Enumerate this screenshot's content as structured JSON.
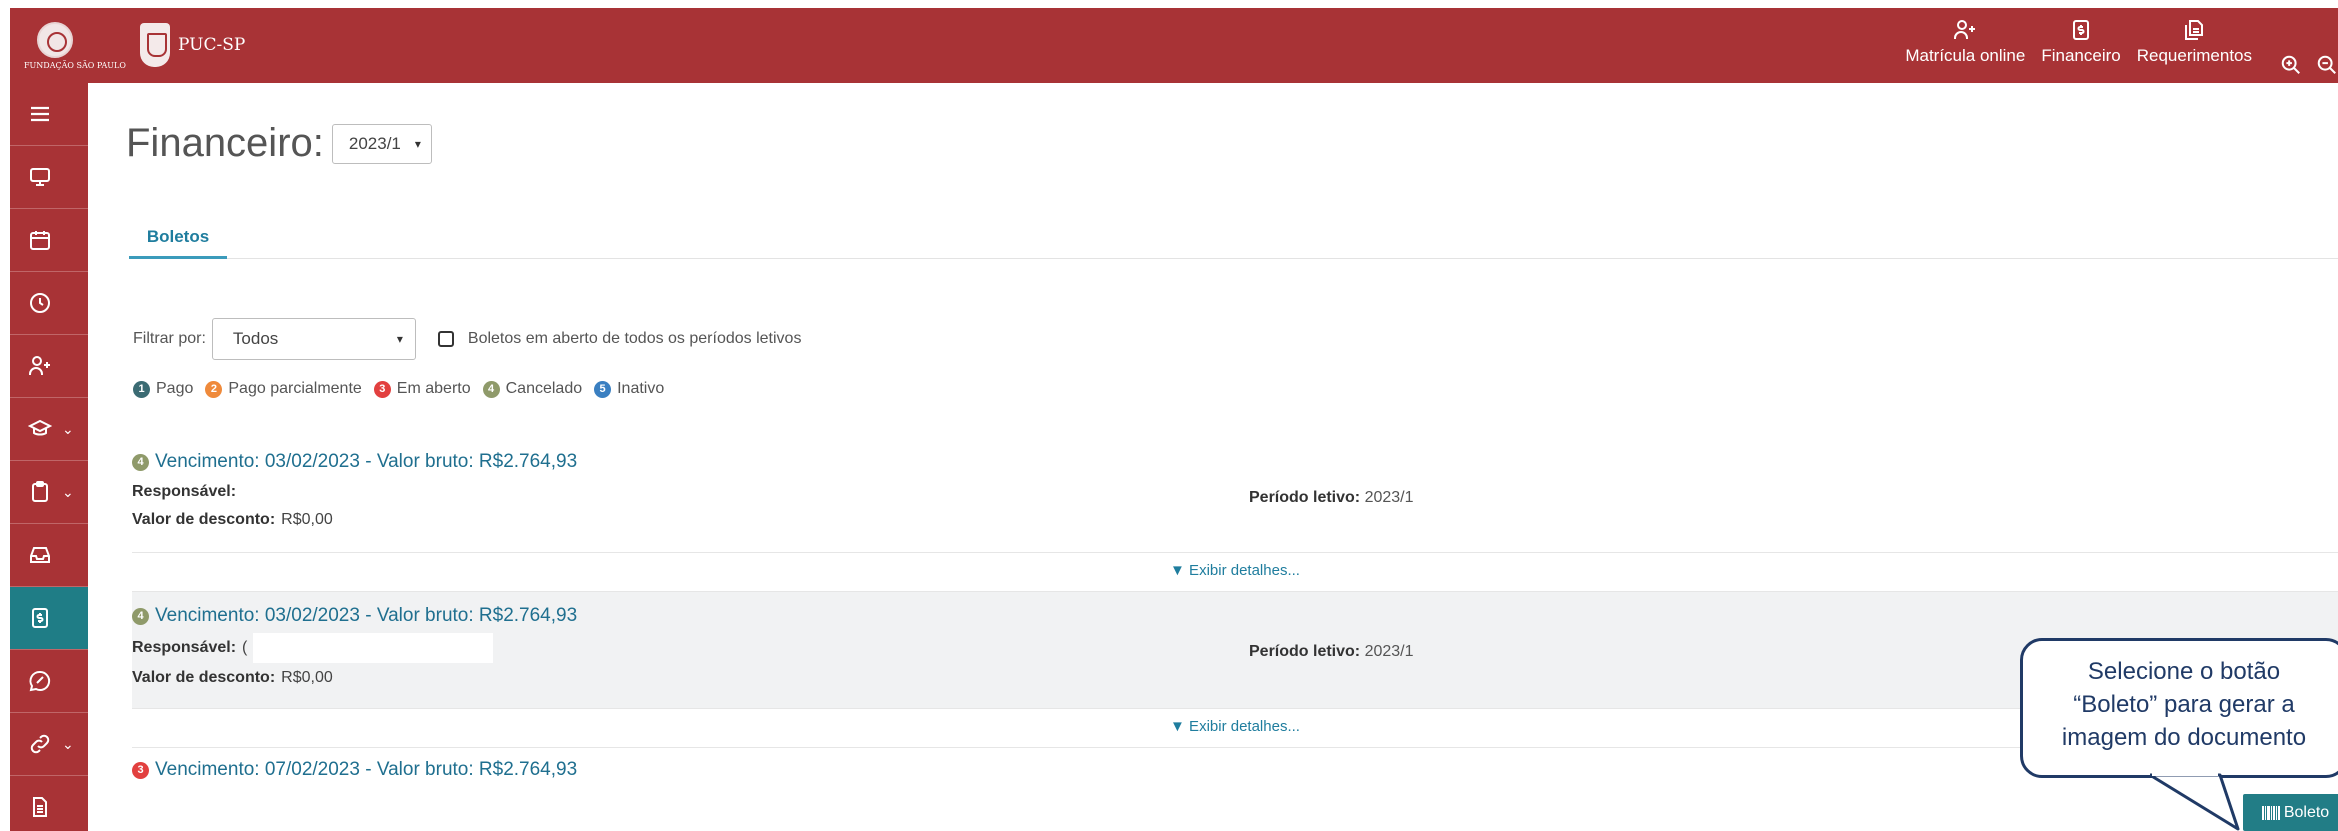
{
  "header": {
    "fsp_logo_caption": "FUNDAÇÃO SÃO PAULO",
    "puc_name": "PUC-SP",
    "links": [
      {
        "label": "Matrícula online",
        "icon": "user-plus-icon"
      },
      {
        "label": "Financeiro",
        "icon": "dollar-doc-icon"
      },
      {
        "label": "Requerimentos",
        "icon": "documents-icon"
      }
    ],
    "brand_color": "#a83336"
  },
  "sidebar": {
    "items": [
      {
        "icon": "menu-icon",
        "chevron": false
      },
      {
        "icon": "monitor-icon",
        "chevron": false
      },
      {
        "icon": "calendar-icon",
        "chevron": false
      },
      {
        "icon": "clock-icon",
        "chevron": false
      },
      {
        "icon": "user-plus-icon",
        "chevron": false
      },
      {
        "icon": "graduation-cap-icon",
        "chevron": true
      },
      {
        "icon": "clipboard-icon",
        "chevron": true
      },
      {
        "icon": "inbox-icon",
        "chevron": false
      },
      {
        "icon": "dollar-doc-icon",
        "chevron": false,
        "active": true
      },
      {
        "icon": "chat-icon",
        "chevron": false
      },
      {
        "icon": "link-icon",
        "chevron": true
      },
      {
        "icon": "document-icon",
        "chevron": false
      }
    ],
    "active_color": "#1f7d86"
  },
  "page": {
    "title": "Financeiro:",
    "period_select": "2023/1",
    "tab": "Boletos"
  },
  "filter": {
    "label": "Filtrar por:",
    "selected": "Todos",
    "checkbox_label": "Boletos em aberto de todos os períodos letivos"
  },
  "legend": [
    {
      "num": "1",
      "label": "Pago",
      "color": "#3b6b73"
    },
    {
      "num": "2",
      "label": "Pago parcialmente",
      "color": "#ef8a3b"
    },
    {
      "num": "3",
      "label": "Em aberto",
      "color": "#e2403f"
    },
    {
      "num": "4",
      "label": "Cancelado",
      "color": "#8f9a6a"
    },
    {
      "num": "5",
      "label": "Inativo",
      "color": "#3a7fc1"
    }
  ],
  "bills": [
    {
      "status_num": "4",
      "status_color": "#8f9a6a",
      "title": "Vencimento: 03/02/2023 - Valor bruto: R$2.764,93",
      "responsavel_label": "Responsável:",
      "periodo_label": "Período letivo:",
      "periodo_value": "2023/1",
      "desconto_label": "Valor de desconto:",
      "desconto_value": "R$0,00",
      "details_label": "▼ Exibir detalhes..."
    },
    {
      "status_num": "4",
      "status_color": "#8f9a6a",
      "title": "Vencimento: 03/02/2023 - Valor bruto: R$2.764,93",
      "responsavel_label": "Responsável:",
      "responsavel_value": "(",
      "periodo_label": "Período letivo:",
      "periodo_value": "2023/1",
      "desconto_label": "Valor de desconto:",
      "desconto_value": "R$0,00",
      "details_label": "▼ Exibir detalhes..."
    },
    {
      "status_num": "3",
      "status_color": "#e2403f",
      "title": "Vencimento: 07/02/2023 - Valor bruto: R$2.764,93"
    }
  ],
  "callout": {
    "line1": "Selecione o botão",
    "line2": "“Boleto” para gerar a",
    "line3": "imagem do documento",
    "border_color": "#203a66"
  },
  "boleto_button": {
    "label": "Boleto",
    "icon": "barcode-icon",
    "color": "#227d86"
  }
}
